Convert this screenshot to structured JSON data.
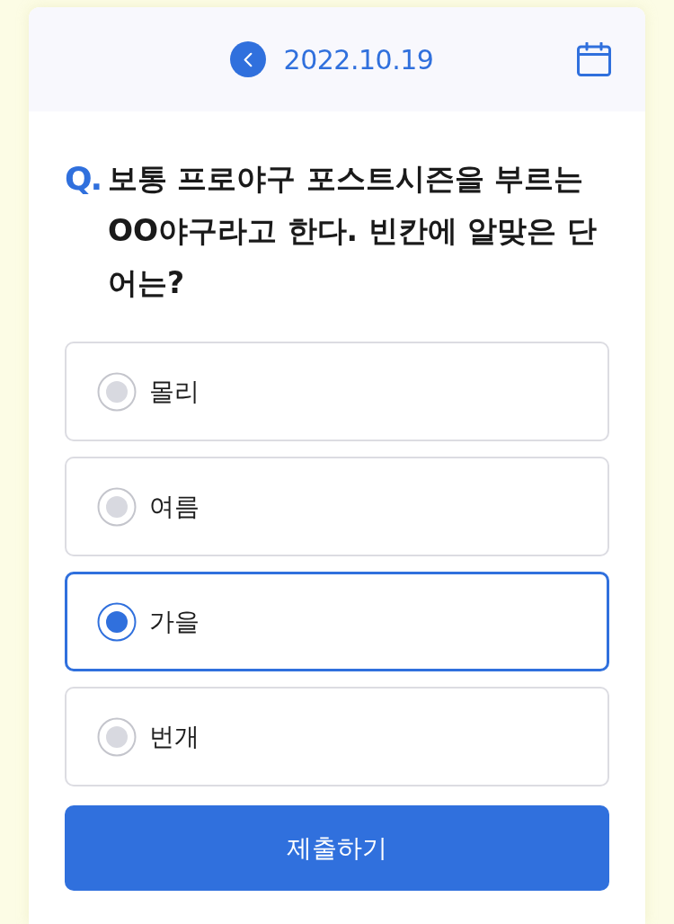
{
  "header": {
    "date": "2022.10.19"
  },
  "question": {
    "prefix": "Q.",
    "text": "보통 프로야구 포스트시즌을 부르는 OO야구라고 한다. 빈칸에 알맞은 단어는?"
  },
  "options": [
    {
      "label": "몰리",
      "selected": false
    },
    {
      "label": "여름",
      "selected": false
    },
    {
      "label": "가을",
      "selected": true
    },
    {
      "label": "번개",
      "selected": false
    }
  ],
  "submit_button": {
    "label": "제출하기"
  }
}
